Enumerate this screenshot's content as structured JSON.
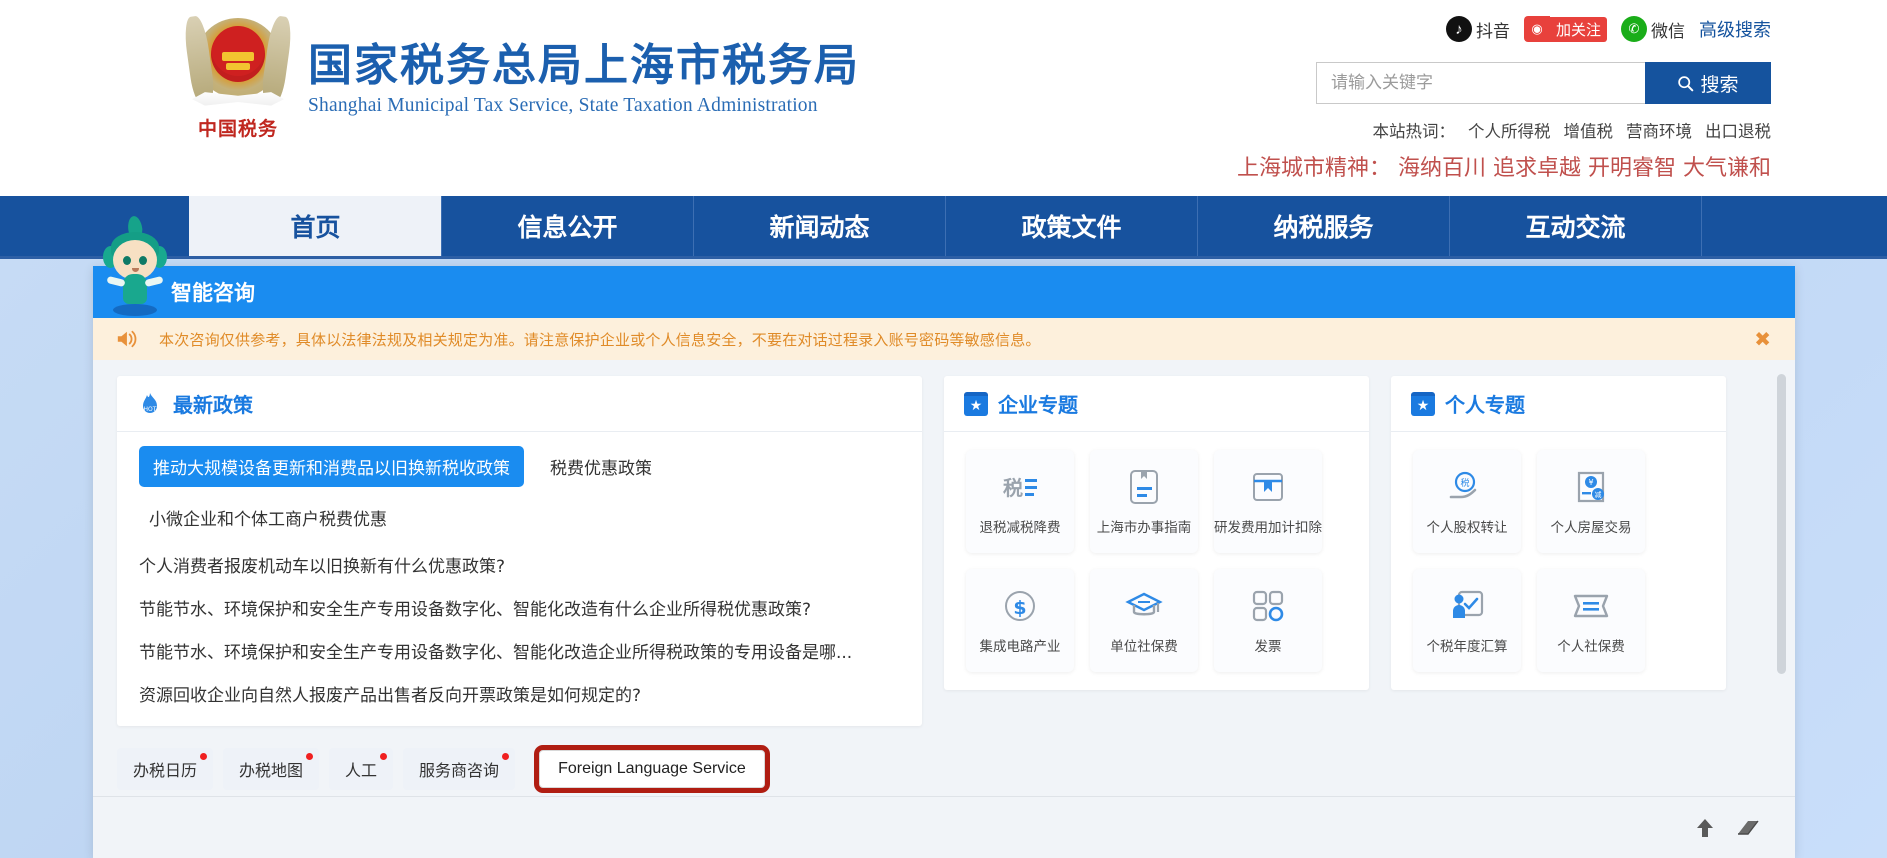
{
  "header": {
    "org_title_cn": "国家税务总局上海市税务局",
    "org_title_en": "Shanghai Municipal Tax Service, State Taxation Administration",
    "emblem_text": "中国税务",
    "social": [
      {
        "icon": "douyin-icon",
        "glyph": "♪",
        "label": "抖音"
      },
      {
        "icon": "weibo-icon",
        "glyph": "☁",
        "label": "加关注"
      },
      {
        "icon": "wechat-icon",
        "glyph": "✉",
        "label": "微信"
      }
    ],
    "advanced_search": "高级搜索",
    "search": {
      "placeholder": "请输入关键字",
      "button_label": "搜索",
      "icon": "search-icon"
    },
    "hotwords_label": "本站热词：",
    "hotwords": [
      "个人所得税",
      "增值税",
      "营商环境",
      "出口退税"
    ],
    "city_spirit": "上海城市精神： 海纳百川 追求卓越 开明睿智 大气谦和",
    "city_spirit_color": "#c0504d"
  },
  "nav": {
    "items": [
      {
        "label": "首页",
        "active": true
      },
      {
        "label": "信息公开",
        "active": false
      },
      {
        "label": "新闻动态",
        "active": false
      },
      {
        "label": "政策文件",
        "active": false
      },
      {
        "label": "纳税服务",
        "active": false
      },
      {
        "label": "互动交流",
        "active": false
      }
    ],
    "bg_color": "#17529e"
  },
  "dialog": {
    "title": "智能咨询",
    "title_bar_color": "#1a8cf0",
    "mascot": "tax-mascot",
    "notice": {
      "icon": "speaker-icon",
      "text": "本次咨询仅供参考，具体以法律法规及相关规定为准。请注意保护企业或个人信息安全，不要在对话过程录入账号密码等敏感信息。",
      "close_label": "✖",
      "bg_color": "#fdf0dc",
      "text_color": "#e08b28"
    }
  },
  "policy_card": {
    "icon": "hot-fire-icon",
    "title": "最新政策",
    "tabs": [
      {
        "label": "推动大规模设备更新和消费品以旧换新税收政策",
        "active": true
      },
      {
        "label": "税费优惠政策",
        "active": false
      }
    ],
    "subtitle": "小微企业和个体工商户税费优惠",
    "questions": [
      "个人消费者报废机动车以旧换新有什么优惠政策?",
      "节能节水、环境保护和安全生产专用设备数字化、智能化改造有什么企业所得税优惠政策?",
      "节能节水、环境保护和安全生产专用设备数字化、智能化改造企业所得税政策的专用设备是哪...",
      "资源回收企业向自然人报废产品出售者反向开票政策是如何规定的?"
    ]
  },
  "enterprise_card": {
    "icon": "star-badge-icon",
    "title": "企业专题",
    "tiles": [
      {
        "label": "退税减税降费",
        "icon": "tax-reduction-icon"
      },
      {
        "label": "上海市办事指南",
        "icon": "guide-document-icon"
      },
      {
        "label": "研发费用加计扣除",
        "icon": "book-bookmark-icon"
      },
      {
        "label": "集成电路产业",
        "icon": "dollar-circle-icon"
      },
      {
        "label": "单位社保费",
        "icon": "graduation-cap-icon"
      },
      {
        "label": "发票",
        "icon": "grid-squares-icon"
      }
    ]
  },
  "personal_card": {
    "icon": "star-badge-icon",
    "title": "个人专题",
    "tiles": [
      {
        "label": "个人股权转让",
        "icon": "hand-tax-icon"
      },
      {
        "label": "个人房屋交易",
        "icon": "money-bag-doc-icon"
      },
      {
        "label": "个税年度汇算",
        "icon": "person-board-icon"
      },
      {
        "label": "个人社保费",
        "icon": "ticket-icon"
      }
    ]
  },
  "quick_buttons": [
    {
      "label": "办税日历",
      "dot": true,
      "highlighted": false
    },
    {
      "label": "办税地图",
      "dot": true,
      "highlighted": false
    },
    {
      "label": "人工",
      "dot": true,
      "highlighted": false
    },
    {
      "label": "服务商咨询",
      "dot": true,
      "highlighted": false
    },
    {
      "label": "Foreign Language Service",
      "dot": false,
      "highlighted": true
    }
  ],
  "highlight_color": "#b01d12",
  "input_tools": [
    {
      "icon": "send-up-arrow-icon",
      "glyph": "⬆"
    },
    {
      "icon": "eraser-icon",
      "glyph": "▱"
    }
  ]
}
